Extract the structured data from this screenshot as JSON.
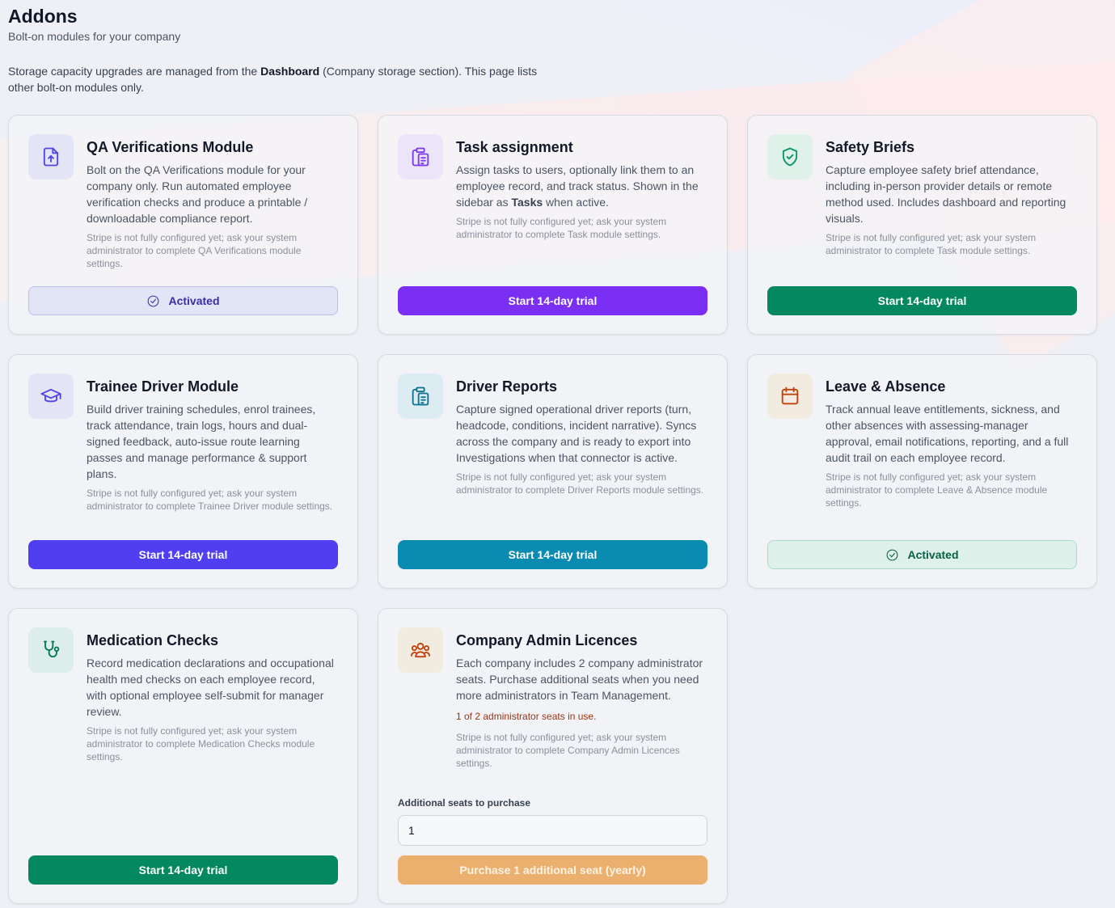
{
  "page": {
    "title": "Addons",
    "subtitle": "Bolt-on modules for your company",
    "notice_pre": "Storage capacity upgrades are managed from the ",
    "notice_bold": "Dashboard",
    "notice_post": " (Company storage section). This page lists other bolt-on modules only."
  },
  "cards": {
    "qa": {
      "icon": "file-upload-icon",
      "title": "QA Verifications Module",
      "desc": "Bolt on the QA Verifications module for your company only. Run automated employee verification checks and produce a printable / downloadable compliance report.",
      "note": "Stripe is not fully configured yet; ask your system administrator to complete QA Verifications module settings.",
      "button": "Activated"
    },
    "task": {
      "icon": "clipboard-list-icon",
      "title": "Task assignment",
      "desc_pre": "Assign tasks to users, optionally link them to an employee record, and track status. Shown in the sidebar as ",
      "desc_bold": "Tasks",
      "desc_post": " when active.",
      "note": "Stripe is not fully configured yet; ask your system administrator to complete Task module settings.",
      "button": "Start 14-day trial"
    },
    "safety": {
      "icon": "shield-check-icon",
      "title": "Safety Briefs",
      "desc": "Capture employee safety brief attendance, including in-person provider details or remote method used. Includes dashboard and reporting visuals.",
      "note": "Stripe is not fully configured yet; ask your system administrator to complete Task module settings.",
      "button": "Start 14-day trial"
    },
    "trainee": {
      "icon": "graduation-cap-icon",
      "title": "Trainee Driver Module",
      "desc": "Build driver training schedules, enrol trainees, track attendance, train logs, hours and dual-signed feedback, auto-issue route learning passes and manage performance & support plans.",
      "note": "Stripe is not fully configured yet; ask your system administrator to complete Trainee Driver module settings.",
      "button": "Start 14-day trial"
    },
    "driver": {
      "icon": "clipboard-list-icon",
      "title": "Driver Reports",
      "desc": "Capture signed operational driver reports (turn, headcode, conditions, incident narrative). Syncs across the company and is ready to export into Investigations when that connector is active.",
      "note": "Stripe is not fully configured yet; ask your system administrator to complete Driver Reports module settings.",
      "button": "Start 14-day trial"
    },
    "leave": {
      "icon": "calendar-icon",
      "title": "Leave & Absence",
      "desc": "Track annual leave entitlements, sickness, and other absences with assessing-manager approval, email notifications, reporting, and a full audit trail on each employee record.",
      "note": "Stripe is not fully configured yet; ask your system administrator to complete Leave & Absence module settings.",
      "button": "Activated"
    },
    "medication": {
      "icon": "stethoscope-icon",
      "title": "Medication Checks",
      "desc": "Record medication declarations and occupational health med checks on each employee record, with optional employee self-submit for manager review.",
      "note": "Stripe is not fully configured yet; ask your system administrator to complete Medication Checks module settings.",
      "button": "Start 14-day trial"
    },
    "admin": {
      "icon": "users-icon",
      "title": "Company Admin Licences",
      "desc": "Each company includes 2 company administrator seats. Purchase additional seats when you need more administrators in Team Management.",
      "usage": "1 of 2 administrator seats in use.",
      "note": "Stripe is not fully configured yet; ask your system administrator to complete Company Admin Licences settings.",
      "field_label": "Additional seats to purchase",
      "field_value": "1",
      "button": "Purchase 1 additional seat (yearly)"
    }
  },
  "colors": {
    "purple": "#7b2ff2",
    "green": "#04895f",
    "indigo": "#4f3ff0",
    "cyan": "#0a8bb2",
    "orange": "#ebb06e"
  }
}
